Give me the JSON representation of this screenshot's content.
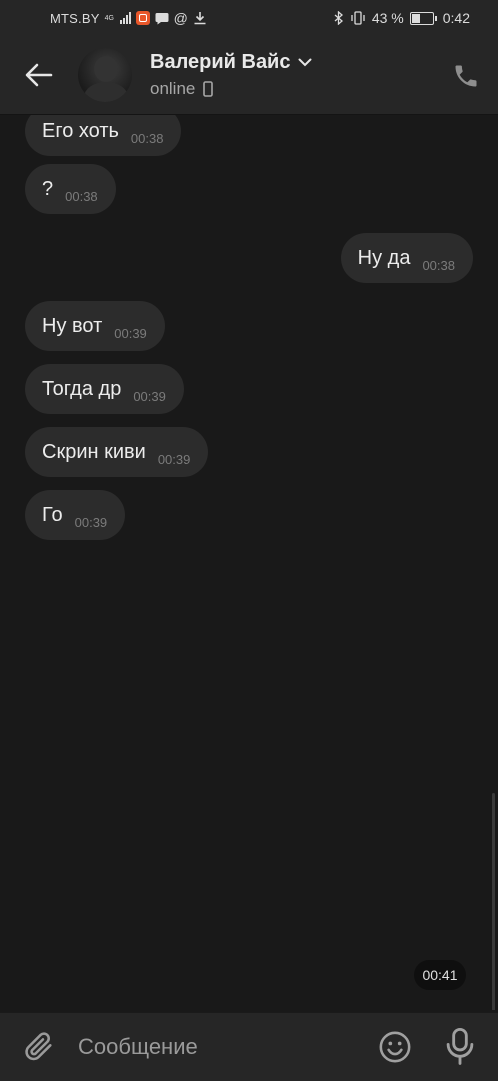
{
  "status_bar": {
    "carrier": "MTS.BY",
    "network": "4G",
    "battery_percent": "43 %",
    "time": "0:42"
  },
  "header": {
    "contact_name": "Валерий Вайс",
    "status": "online"
  },
  "messages": [
    {
      "text": "Его хоть",
      "time": "00:38",
      "side": "in"
    },
    {
      "text": "?",
      "time": "00:38",
      "side": "in"
    },
    {
      "text": "Ну да",
      "time": "00:38",
      "side": "out"
    },
    {
      "text": "Ну вот",
      "time": "00:39",
      "side": "in"
    },
    {
      "text": "Тогда др",
      "time": "00:39",
      "side": "in"
    },
    {
      "text": "Скрин киви",
      "time": "00:39",
      "side": "in"
    },
    {
      "text": "Го",
      "time": "00:39",
      "side": "in"
    }
  ],
  "floating_time": "00:41",
  "composer": {
    "placeholder": "Сообщение"
  },
  "colors": {
    "background": "#191919",
    "bar": "#262626",
    "bubble": "#2c2c2c",
    "text": "#e9e9e9",
    "muted": "#7b7b7b"
  },
  "icons": [
    "back-arrow-icon",
    "chevron-down-icon",
    "phone-device-icon",
    "phone-icon",
    "paperclip-icon",
    "emoji-icon",
    "microphone-icon"
  ]
}
